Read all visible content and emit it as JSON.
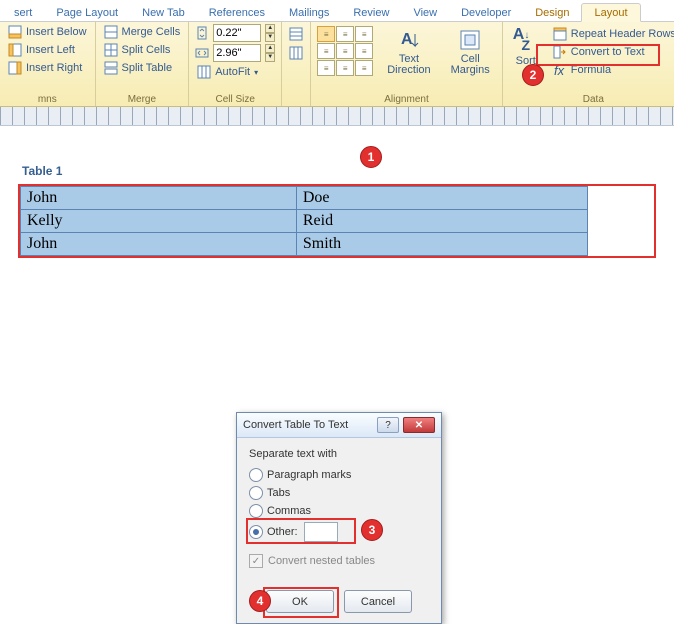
{
  "tabs": [
    "sert",
    "Page Layout",
    "New Tab",
    "References",
    "Mailings",
    "Review",
    "View",
    "Developer",
    "Design",
    "Layout"
  ],
  "active_tab_index": 9,
  "ribbon": {
    "rows_columns": {
      "label": "mns",
      "insert_below": "Insert Below",
      "insert_left": "Insert Left",
      "insert_right": "Insert Right"
    },
    "merge": {
      "label": "Merge",
      "merge_cells": "Merge Cells",
      "split_cells": "Split Cells",
      "split_table": "Split Table"
    },
    "cell_size": {
      "label": "Cell Size",
      "height": "0.22\"",
      "width": "2.96\"",
      "autofit": "AutoFit"
    },
    "alignment": {
      "label": "Alignment",
      "text_direction": "Text\nDirection",
      "cell_margins": "Cell\nMargins"
    },
    "data": {
      "label": "Data",
      "sort": "Sort",
      "repeat_header": "Repeat Header Rows",
      "convert": "Convert to Text",
      "formula": "Formula"
    }
  },
  "caption": "Table 1",
  "table_rows": [
    [
      "John",
      "Doe"
    ],
    [
      "Kelly",
      "Reid"
    ],
    [
      "John",
      "Smith"
    ]
  ],
  "dialog": {
    "title": "Convert Table To Text",
    "group": "Separate text with",
    "opt_paragraph": "Paragraph marks",
    "opt_tabs": "Tabs",
    "opt_commas": "Commas",
    "opt_other": "Other:",
    "other_value": "",
    "nested": "Convert nested tables",
    "ok": "OK",
    "cancel": "Cancel"
  },
  "callouts": {
    "c1": "1",
    "c2": "2",
    "c3": "3",
    "c4": "4"
  }
}
